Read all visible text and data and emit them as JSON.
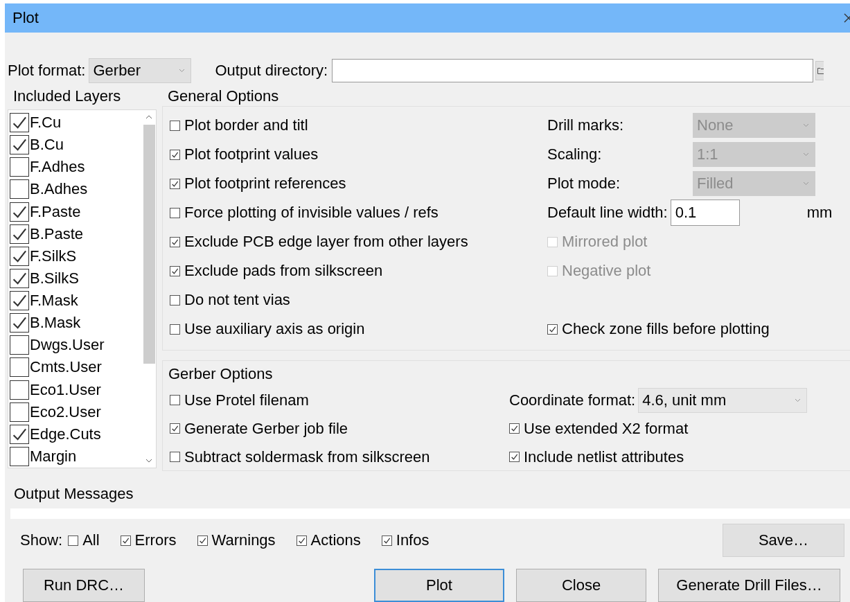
{
  "window": {
    "title": "Plot"
  },
  "plot_format": {
    "label": "Plot format:",
    "value": "Gerber"
  },
  "output_directory": {
    "label": "Output directory:"
  },
  "included_layers": {
    "title": "Included Layers",
    "items": [
      {
        "label": "F.Cu",
        "checked": true
      },
      {
        "label": "B.Cu",
        "checked": true
      },
      {
        "label": "F.Adhes",
        "checked": false
      },
      {
        "label": "B.Adhes",
        "checked": false
      },
      {
        "label": "F.Paste",
        "checked": true
      },
      {
        "label": "B.Paste",
        "checked": true
      },
      {
        "label": "F.SilkS",
        "checked": true
      },
      {
        "label": "B.SilkS",
        "checked": true
      },
      {
        "label": "F.Mask",
        "checked": true
      },
      {
        "label": "B.Mask",
        "checked": true
      },
      {
        "label": "Dwgs.User",
        "checked": false
      },
      {
        "label": "Cmts.User",
        "checked": false
      },
      {
        "label": "Eco1.User",
        "checked": false
      },
      {
        "label": "Eco2.User",
        "checked": false
      },
      {
        "label": "Edge.Cuts",
        "checked": true
      },
      {
        "label": "Margin",
        "checked": false
      }
    ]
  },
  "general_options": {
    "title": "General Options",
    "options": [
      {
        "label": "Plot border and titl",
        "checked": false
      },
      {
        "label": "Plot footprint values",
        "checked": true
      },
      {
        "label": "Plot footprint references",
        "checked": true
      },
      {
        "label": "Force plotting of invisible values / refs",
        "checked": false
      },
      {
        "label": "Exclude PCB edge layer from other layers",
        "checked": true
      },
      {
        "label": "Exclude pads from silkscreen",
        "checked": true
      },
      {
        "label": "Do not tent vias",
        "checked": false
      },
      {
        "label": "Use auxiliary axis as origin",
        "checked": false
      }
    ],
    "settings": [
      {
        "kind": "dropdown",
        "label": "Drill marks:",
        "value": "None",
        "disabled": true
      },
      {
        "kind": "dropdown",
        "label": "Scaling:",
        "value": "1:1",
        "disabled": true
      },
      {
        "kind": "dropdown",
        "label": "Plot mode:",
        "value": "Filled",
        "disabled": true
      },
      {
        "kind": "input",
        "label": "Default line width:",
        "value": "0.1",
        "unit": "mm"
      },
      {
        "kind": "checkbox",
        "label": "Mirrored plot",
        "checked": false,
        "disabled": true
      },
      {
        "kind": "checkbox",
        "label": "Negative plot",
        "checked": false,
        "disabled": true
      },
      {
        "kind": "checkbox",
        "label": "Check zone fills before plotting",
        "checked": true,
        "disabled": false
      }
    ]
  },
  "gerber_options": {
    "title": "Gerber Options",
    "options": [
      {
        "label": "Use Protel filenam",
        "checked": false
      },
      {
        "label": "Generate Gerber job file",
        "checked": true
      },
      {
        "label": "Subtract soldermask from silkscreen",
        "checked": false
      }
    ],
    "coordinate_format": {
      "label": "Coordinate format:",
      "value": "4.6, unit mm"
    },
    "settings": [
      {
        "label": "Use extended X2 format",
        "checked": true
      },
      {
        "label": "Include netlist attributes",
        "checked": true
      }
    ]
  },
  "output_messages": {
    "title": "Output Messages",
    "show_label": "Show:",
    "filters": [
      {
        "label": "All",
        "checked": false
      },
      {
        "label": "Errors",
        "checked": true
      },
      {
        "label": "Warnings",
        "checked": true
      },
      {
        "label": "Actions",
        "checked": true
      },
      {
        "label": "Infos",
        "checked": true
      }
    ],
    "save_button": "Save…"
  },
  "buttons": [
    {
      "label": "Run DRC…",
      "default": false
    },
    {
      "label": "Plot",
      "default": true
    },
    {
      "label": "Close",
      "default": false
    },
    {
      "label": "Generate Drill Files…",
      "default": false
    }
  ]
}
